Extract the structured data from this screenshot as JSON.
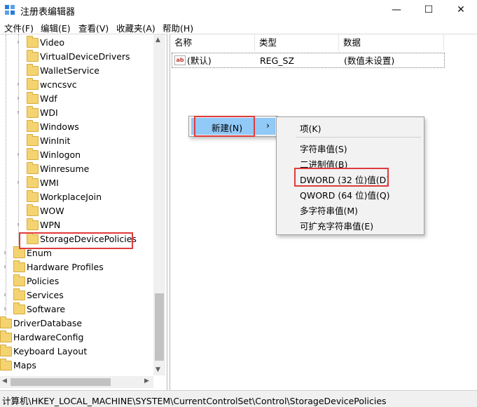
{
  "window": {
    "title": "注册表编辑器",
    "minimize": "—",
    "maximize": "☐",
    "close": "✕"
  },
  "menu": [
    "文件(F)",
    "编辑(E)",
    "查看(V)",
    "收藏夹(A)",
    "帮助(H)"
  ],
  "tree": [
    {
      "label": "Video",
      "expand": "›"
    },
    {
      "label": "VirtualDeviceDrivers",
      "expand": ""
    },
    {
      "label": "WalletService",
      "expand": ""
    },
    {
      "label": "wcncsvc",
      "expand": "›"
    },
    {
      "label": "Wdf",
      "expand": "›"
    },
    {
      "label": "WDI",
      "expand": "›"
    },
    {
      "label": "Windows",
      "expand": ""
    },
    {
      "label": "WinInit",
      "expand": ""
    },
    {
      "label": "Winlogon",
      "expand": "›"
    },
    {
      "label": "Winresume",
      "expand": ""
    },
    {
      "label": "WMI",
      "expand": "›"
    },
    {
      "label": "WorkplaceJoin",
      "expand": ""
    },
    {
      "label": "WOW",
      "expand": ""
    },
    {
      "label": "WPN",
      "expand": "›"
    },
    {
      "label": "StorageDevicePolicies",
      "expand": ""
    },
    {
      "label": "Enum",
      "expand": "›"
    },
    {
      "label": "Hardware Profiles",
      "expand": "›"
    },
    {
      "label": "Policies",
      "expand": ""
    },
    {
      "label": "Services",
      "expand": "›"
    },
    {
      "label": "Software",
      "expand": "›"
    },
    {
      "label": "DriverDatabase",
      "expand": ""
    },
    {
      "label": "HardwareConfig",
      "expand": ""
    },
    {
      "label": "Keyboard Layout",
      "expand": ""
    },
    {
      "label": "Maps",
      "expand": ""
    }
  ],
  "list": {
    "headers": [
      "名称",
      "类型",
      "数据"
    ],
    "rows": [
      {
        "name": "(默认)",
        "type": "REG_SZ",
        "data": "(数值未设置)",
        "icon": "ab"
      }
    ]
  },
  "context_menu": {
    "new": "新建(N)",
    "arrow": "›"
  },
  "submenu": [
    "项(K)",
    "字符串值(S)",
    "二进制值(B)",
    "DWORD (32 位)值(D)",
    "QWORD (64 位)值(Q)",
    "多字符串值(M)",
    "可扩充字符串值(E)"
  ],
  "status": "计算机\\HKEY_LOCAL_MACHINE\\SYSTEM\\CurrentControlSet\\Control\\StorageDevicePolicies",
  "colors": {
    "highlight": "#91c9f7",
    "annotation": "#e03b3b",
    "folder": "#f4d371"
  }
}
